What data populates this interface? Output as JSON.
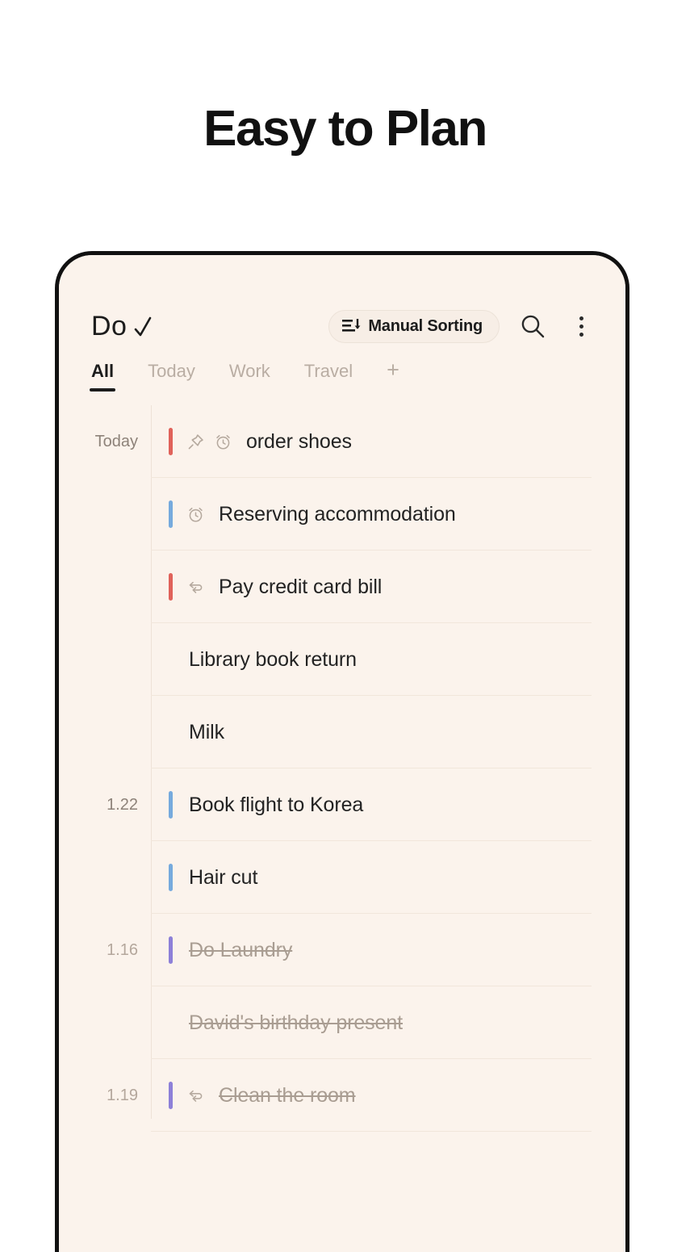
{
  "page": {
    "headline": "Easy to Plan",
    "background": "#ffffff",
    "screen_background": "#fbf3ec"
  },
  "app": {
    "brand_name": "Do",
    "brand_check_icon": "check-icon",
    "sort": {
      "label": "Manual Sorting",
      "icon": "sort-icon"
    },
    "search_icon": "search-icon",
    "overflow_icon": "more-vertical-icon"
  },
  "tabs": [
    {
      "label": "All",
      "active": true
    },
    {
      "label": "Today",
      "active": false
    },
    {
      "label": "Work",
      "active": false
    },
    {
      "label": "Travel",
      "active": false
    }
  ],
  "tab_add_label": "+",
  "colors": {
    "priority_red": "#e0625a",
    "priority_blue": "#76aadd",
    "priority_purple": "#8d80d8",
    "accent_text": "#1c1c1c",
    "muted_text": "#b9ada3",
    "done_text": "#a99d92",
    "divider": "#f1e6db"
  },
  "tasks": [
    {
      "date": "Today",
      "priority": "red",
      "icons": [
        "pin-icon",
        "alarm-icon"
      ],
      "title": "order shoes",
      "done": false
    },
    {
      "date": "",
      "priority": "blue",
      "icons": [
        "alarm-icon"
      ],
      "title": "Reserving accommodation",
      "done": false
    },
    {
      "date": "",
      "priority": "red",
      "icons": [
        "repeat-icon"
      ],
      "title": "Pay credit card bill",
      "done": false
    },
    {
      "date": "",
      "priority": "none",
      "icons": [],
      "title": "Library book return",
      "done": false
    },
    {
      "date": "",
      "priority": "none",
      "icons": [],
      "title": "Milk",
      "done": false
    },
    {
      "date": "1.22",
      "priority": "blue",
      "icons": [],
      "title": "Book flight to Korea",
      "done": false
    },
    {
      "date": "",
      "priority": "blue",
      "icons": [],
      "title": "Hair cut",
      "done": false
    },
    {
      "date": "1.16",
      "priority": "purple",
      "icons": [],
      "title": "Do Laundry",
      "done": true
    },
    {
      "date": "",
      "priority": "none",
      "icons": [],
      "title": "David's birthday present",
      "done": true
    },
    {
      "date": "1.19",
      "priority": "purple",
      "icons": [
        "repeat-icon"
      ],
      "title": "Clean the room",
      "done": true
    }
  ]
}
